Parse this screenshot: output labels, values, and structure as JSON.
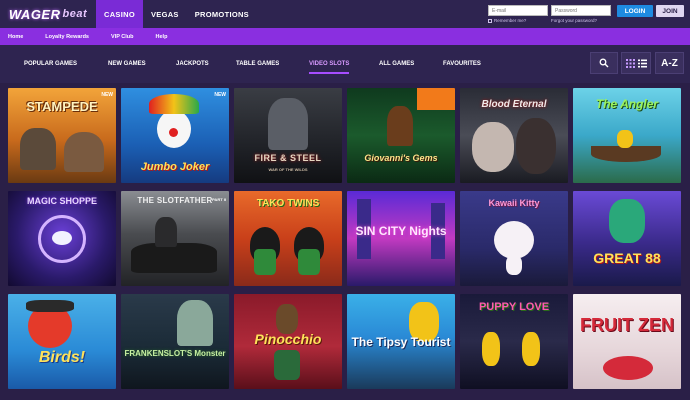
{
  "header": {
    "logo_main": "WAGER",
    "logo_sub": "beat",
    "nav": [
      "CASINO",
      "VEGAS",
      "PROMOTIONS"
    ],
    "email_placeholder": "E-mail",
    "password_placeholder": "Password",
    "remember_me": "Remember me?",
    "forgot_password": "Forgot your password?",
    "login_label": "LOGIN",
    "join_label": "JOIN"
  },
  "subnav": [
    "Home",
    "Loyalty Rewards",
    "VIP Club",
    "Help"
  ],
  "categories": [
    "POPULAR GAMES",
    "NEW GAMES",
    "JACKPOTS",
    "TABLE GAMES",
    "VIDEO SLOTS",
    "ALL GAMES",
    "FAVOURITES"
  ],
  "active_category": "VIDEO SLOTS",
  "tools": {
    "search_icon": "search-icon",
    "grid_icon": "grid-icon",
    "list_icon": "list-icon",
    "az_label": "A-Z"
  },
  "new_badge": "NEW",
  "games": [
    {
      "title": "STAMPEDE",
      "new": true
    },
    {
      "title": "Jumbo Joker",
      "new": true
    },
    {
      "title": "FIRE & STEEL",
      "subtitle": "WAR OF THE WILDS"
    },
    {
      "title": "Giovanni's Gems"
    },
    {
      "title": "Blood Eternal"
    },
    {
      "title": "The Angler"
    },
    {
      "title": "MAGIC SHOPPE"
    },
    {
      "title": "THE SLOTFATHER",
      "subtitle": "PART II"
    },
    {
      "title": "TAKO TWINS"
    },
    {
      "title": "SIN CITY Nights"
    },
    {
      "title": "Kawaii Kitty"
    },
    {
      "title": "GREAT 88"
    },
    {
      "title": "Birds!"
    },
    {
      "title": "FRANKENSLOT'S Monster"
    },
    {
      "title": "Pinocchio"
    },
    {
      "title": "The Tipsy Tourist"
    },
    {
      "title": "PUPPY LOVE"
    },
    {
      "title": "FRUIT ZEN"
    }
  ],
  "colors": {
    "accent": "#8a2fe0",
    "active_tab": "#7a2bd6",
    "login_button": "#1e8be0",
    "page_bg": "#2a1f47"
  }
}
